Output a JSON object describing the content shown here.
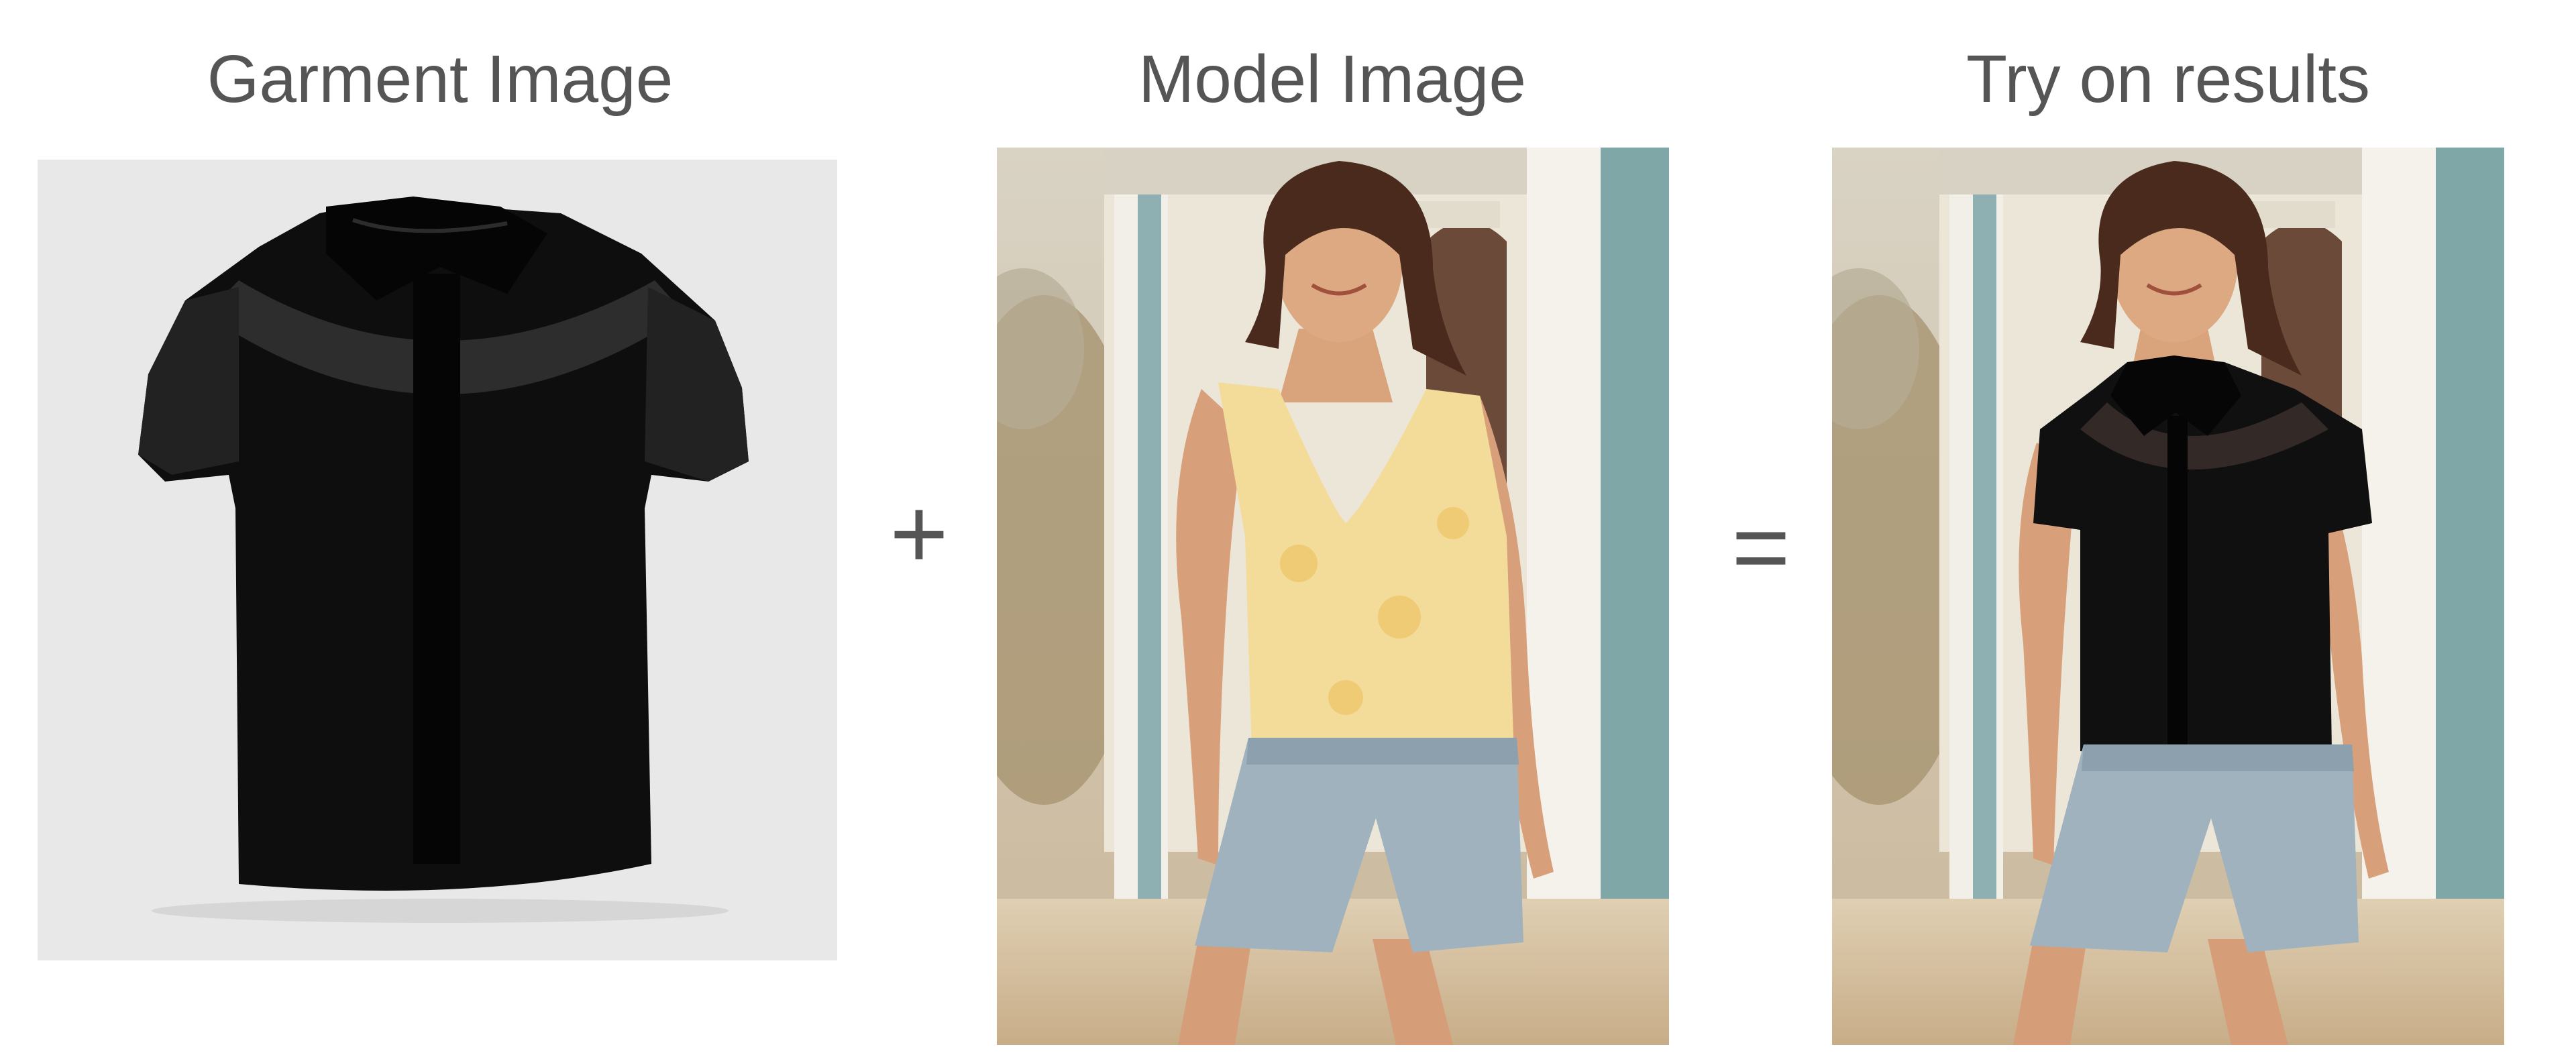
{
  "headings": {
    "garment": "Garment Image",
    "model": "Model Image",
    "result": "Try on results"
  },
  "operators": {
    "plus": "+",
    "equals": "="
  },
  "images": {
    "garment": {
      "subject": "black sheer short-sleeve collared blouse",
      "background": "#e8e8e8"
    },
    "model": {
      "subject": "smiling woman in yellow floral tank top and denim shorts",
      "background": "sunlit building with pillars"
    },
    "result": {
      "subject": "same woman wearing the black sheer blouse and denim shorts",
      "background": "sunlit building with pillars"
    }
  },
  "colors": {
    "text": "#555555",
    "garment": "#0d0d0d",
    "tank_top": "#f3dc9a",
    "denim": "#9fb2bd",
    "pillar_teal": "#7fa7a8"
  }
}
